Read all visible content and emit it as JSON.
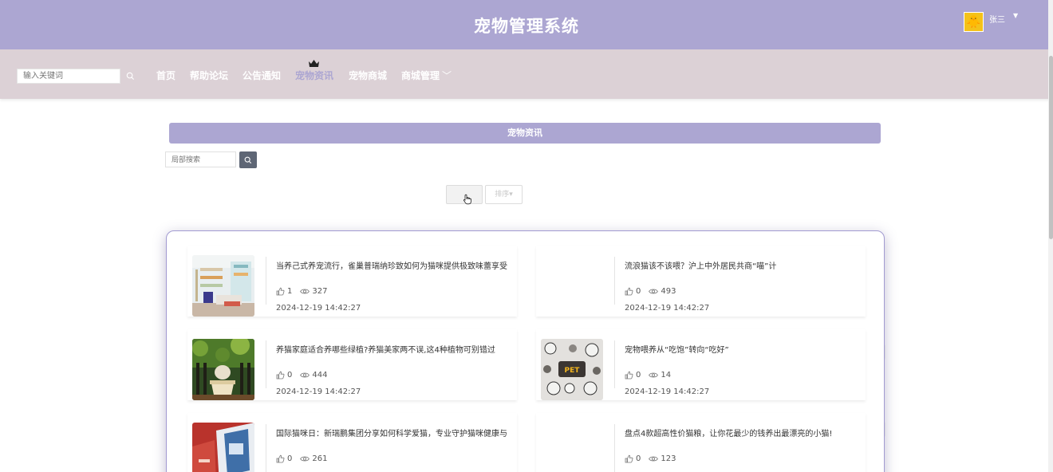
{
  "header": {
    "title": "宠物管理系统",
    "user_name": "张三",
    "user_caret": "▼"
  },
  "nav": {
    "search_placeholder": "输入关键词",
    "items": [
      "首页",
      "帮助论坛",
      "公告通知",
      "宠物资讯",
      "宠物商城",
      "商城管理"
    ],
    "active_item": "宠物资讯",
    "dropdown_chevron": "﹀"
  },
  "page": {
    "section_title": "宠物资讯",
    "local_search_placeholder": "局部搜索",
    "sort_label": "排序",
    "sort_caret": "▾"
  },
  "news": [
    {
      "title": "当养己式养宠流行，雀巢普瑞纳珍致如何为猫咪提供极致味蕾享受",
      "likes": "1",
      "views": "327",
      "date": "2024-12-19 14:42:27",
      "thumb": "cat-shop-photo"
    },
    {
      "title": "流浪猫该不该喂？沪上中外居民共商“喵”计",
      "likes": "0",
      "views": "493",
      "date": "2024-12-19 14:42:27",
      "thumb": "none"
    },
    {
      "title": "养猫家庭适合养哪些绿植?养猫美家两不误,这4种植物可别错过",
      "likes": "0",
      "views": "444",
      "date": "2024-12-19 14:42:27",
      "thumb": "cat-plants-photo"
    },
    {
      "title": "宠物喂养从“吃饱”转向“吃好”",
      "likes": "0",
      "views": "14",
      "date": "2024-12-19 14:42:27",
      "thumb": "pet-shop-sticker"
    },
    {
      "title": "国际猫咪日：新瑞鹏集团分享如何科学爱猫，专业守护猫咪健康与",
      "likes": "0",
      "views": "261",
      "date": "",
      "thumb": "books-photo"
    },
    {
      "title": "盘点4款超高性价猫粮，让你花最少的钱养出最漂亮的小猫!",
      "likes": "0",
      "views": "123",
      "date": "",
      "thumb": "none"
    }
  ],
  "colors": {
    "header_bg": "#aca6d2",
    "nav_bg": "#dcd1d6",
    "accent": "#aca6d2",
    "search_button": "#5e6675"
  }
}
